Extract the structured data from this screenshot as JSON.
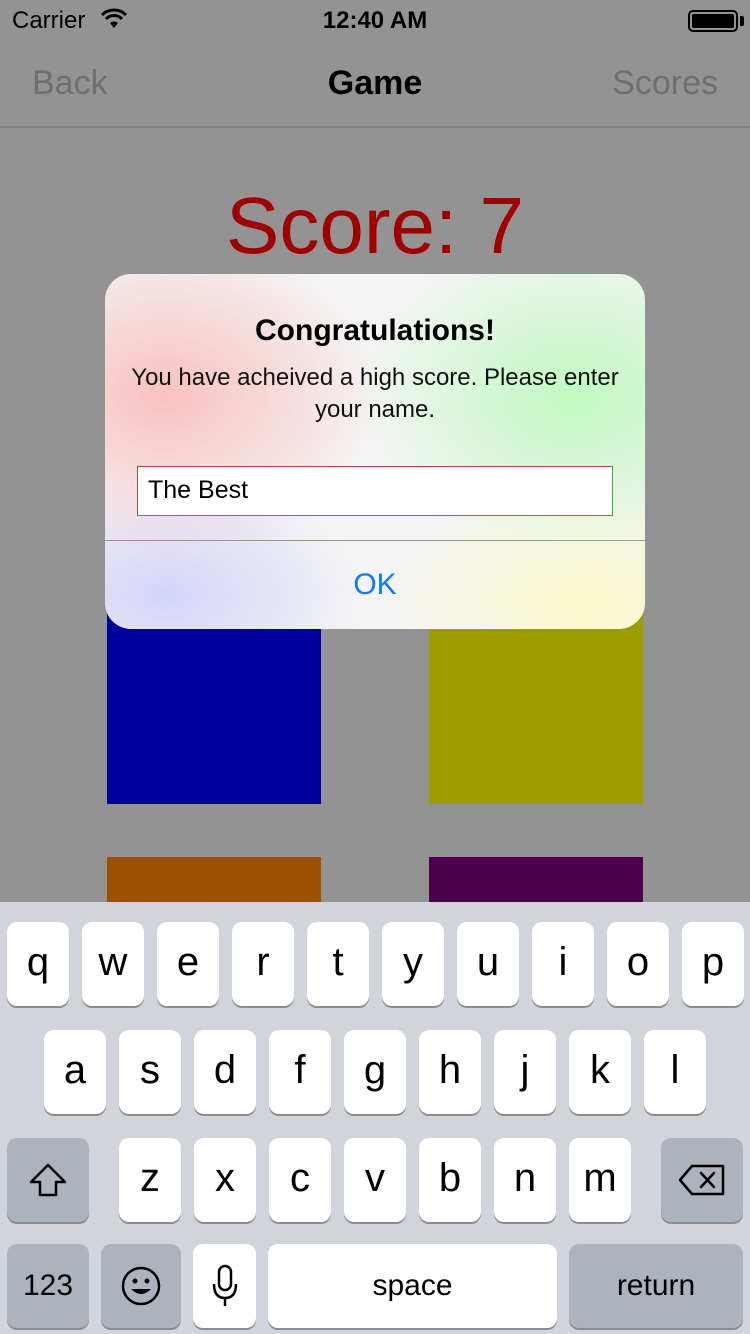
{
  "status_bar": {
    "carrier": "Carrier",
    "time": "12:40 AM"
  },
  "nav": {
    "back": "Back",
    "title": "Game",
    "scores": "Scores"
  },
  "score_text": "Score: 7",
  "tiles": {
    "colors": [
      "#00009c",
      "#9c9c00",
      "#9c5000",
      "#4c004c"
    ]
  },
  "alert": {
    "title": "Congratulations!",
    "message": "You have acheived a high score. Please enter your name.",
    "input_value": "The Best",
    "ok": "OK"
  },
  "keyboard": {
    "row1": [
      "q",
      "w",
      "e",
      "r",
      "t",
      "y",
      "u",
      "i",
      "o",
      "p"
    ],
    "row2": [
      "a",
      "s",
      "d",
      "f",
      "g",
      "h",
      "j",
      "k",
      "l"
    ],
    "row3": [
      "z",
      "x",
      "c",
      "v",
      "b",
      "n",
      "m"
    ],
    "numbers_key": "123",
    "space_key": "space",
    "return_key": "return",
    "icons": [
      "shift-icon",
      "backspace-icon",
      "emoji-icon",
      "microphone-icon"
    ]
  },
  "colors": {
    "score_red": "#a00000",
    "link_blue": "#0a7bff",
    "keyboard_bg": "#d1d4db"
  }
}
